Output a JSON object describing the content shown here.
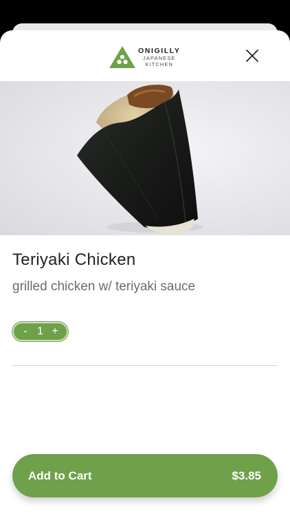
{
  "brand": {
    "name": "ONIGILLY",
    "subtitle_line1": "JAPANESE",
    "subtitle_line2": "KITCHEN",
    "color": "#6fa04a"
  },
  "header": {
    "close_icon": "close-icon"
  },
  "product": {
    "image_subject": "onigiri-triangle-nori-teriyaki-chicken",
    "title": "Teriyaki Chicken",
    "description": "grilled chicken w/ teriyaki sauce"
  },
  "quantity": {
    "decrement_label": "-",
    "value": "1",
    "increment_label": "+"
  },
  "cart": {
    "label": "Add to Cart",
    "price": "$3.85"
  },
  "colors": {
    "accent": "#6fa04a",
    "text_primary": "#222222",
    "text_secondary": "#6b6b6b"
  }
}
